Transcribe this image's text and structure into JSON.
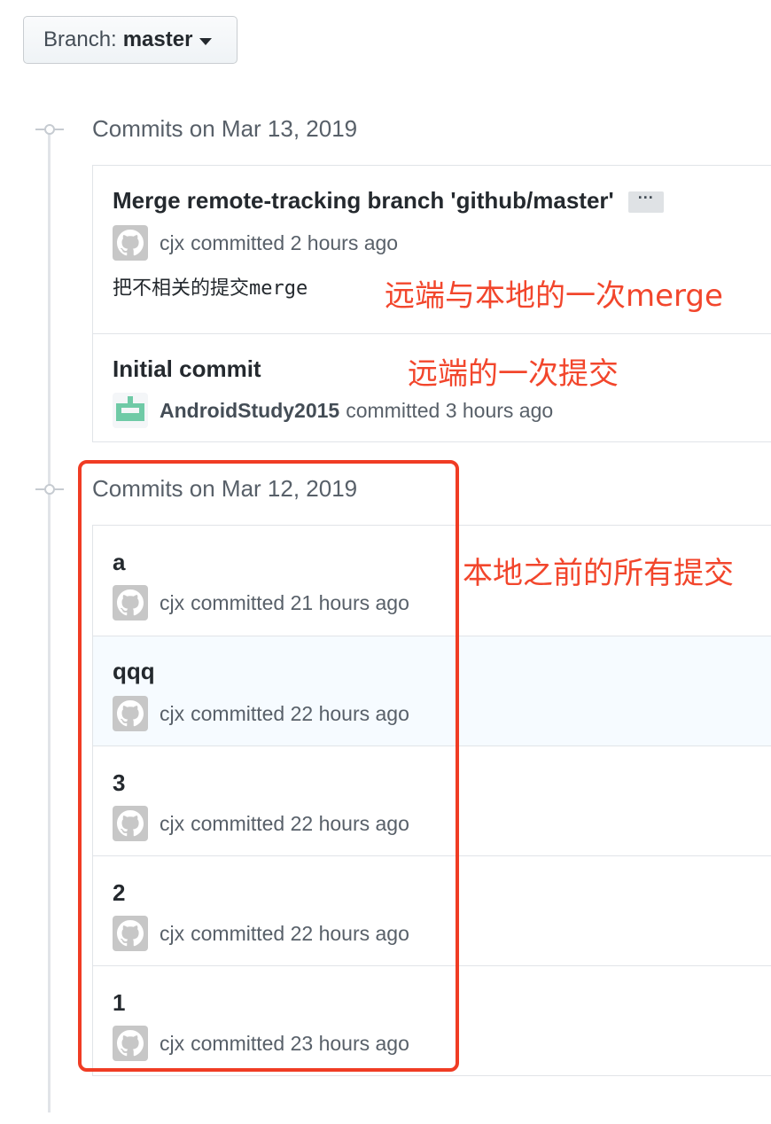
{
  "branch": {
    "prefix": "Branch:",
    "name": "master"
  },
  "groups": [
    {
      "title": "Commits on Mar 13, 2019",
      "commits": [
        {
          "message": "Merge remote-tracking branch 'github/master'",
          "author": "cjx",
          "action": "committed 2 hours ago",
          "description_cn": "把不相关的提交",
          "description_mono": "merge",
          "has_ellipsis": true,
          "avatar": "github-octocat-icon"
        },
        {
          "message": "Initial commit",
          "author": "AndroidStudy2015",
          "action": "committed 3 hours ago",
          "avatar": "identicon-icon"
        }
      ]
    },
    {
      "title": "Commits on Mar 12, 2019",
      "commits": [
        {
          "message": "a",
          "author": "cjx",
          "action": "committed 21 hours ago",
          "avatar": "github-octocat-icon"
        },
        {
          "message": "qqq",
          "author": "cjx",
          "action": "committed 22 hours ago",
          "avatar": "github-octocat-icon"
        },
        {
          "message": "3",
          "author": "cjx",
          "action": "committed 22 hours ago",
          "avatar": "github-octocat-icon"
        },
        {
          "message": "2",
          "author": "cjx",
          "action": "committed 22 hours ago",
          "avatar": "github-octocat-icon"
        },
        {
          "message": "1",
          "author": "cjx",
          "action": "committed 23 hours ago",
          "avatar": "github-octocat-icon"
        }
      ]
    }
  ],
  "annotations": {
    "merge": "远端与本地的一次merge",
    "initial": "远端的一次提交",
    "local": "本地之前的所有提交"
  },
  "colors": {
    "annotation": "#f2462c",
    "highlight_row": "#f6fbff"
  }
}
